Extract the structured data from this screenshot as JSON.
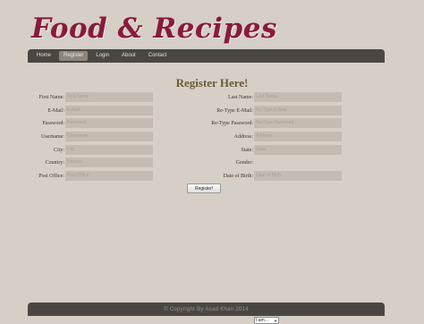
{
  "logo": "Food & Recipes",
  "nav": [
    "Home",
    "Register",
    "Login",
    "About",
    "Contact"
  ],
  "title": "Register Here!",
  "left_fields": [
    {
      "label": "First Name:",
      "placeholder": "First Name"
    },
    {
      "label": "E-Mail:",
      "placeholder": "E-Mail"
    },
    {
      "label": "Password:",
      "placeholder": "Password"
    },
    {
      "label": "Username:",
      "placeholder": "Username"
    },
    {
      "label": "City:",
      "placeholder": "City"
    },
    {
      "label": "Country:",
      "placeholder": "Country"
    },
    {
      "label": "Post Office:",
      "placeholder": "Post Office"
    }
  ],
  "right_fields": [
    {
      "label": "Last Name:",
      "placeholder": "Last Name"
    },
    {
      "label": "Re-Type E-Mail:",
      "placeholder": "Re-Type E-Mail"
    },
    {
      "label": "Re-Type Password:",
      "placeholder": "Re-Type Password"
    },
    {
      "label": "Address:",
      "placeholder": "Address"
    },
    {
      "label": "State:",
      "placeholder": "State"
    }
  ],
  "gender": {
    "label": "Gender:",
    "value": "I am..."
  },
  "dob": {
    "label": "Date of Birth:",
    "placeholder": "Date of Birth"
  },
  "register_button": "Register!",
  "footer": "© Copyright By Asad Khan 2014"
}
